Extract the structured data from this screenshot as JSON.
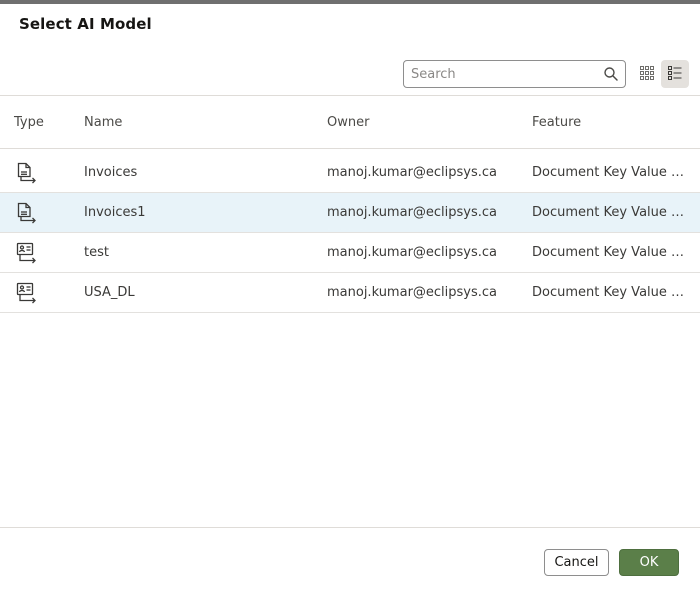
{
  "dialog": {
    "title": "Select AI Model"
  },
  "search": {
    "placeholder": "Search",
    "value": ""
  },
  "view_modes": {
    "grid_icon": "grid-view-icon",
    "list_icon": "list-view-icon",
    "selected": "list"
  },
  "table": {
    "columns": [
      "Type",
      "Name",
      "Owner",
      "Feature"
    ],
    "rows": [
      {
        "type_icon": "document-export-icon",
        "name": "Invoices",
        "owner": "manoj.kumar@eclipsys.ca",
        "feature": "Document Key Value Extraction"
      },
      {
        "type_icon": "document-export-icon",
        "name": "Invoices1",
        "owner": "manoj.kumar@eclipsys.ca",
        "feature": "Document Key Value Extraction"
      },
      {
        "type_icon": "id-card-export-icon",
        "name": "test",
        "owner": "manoj.kumar@eclipsys.ca",
        "feature": "Document Key Value Extraction"
      },
      {
        "type_icon": "id-card-export-icon",
        "name": "USA_DL",
        "owner": "manoj.kumar@eclipsys.ca",
        "feature": "Document Key Value Extraction"
      }
    ],
    "selected_row": 1
  },
  "footer": {
    "cancel_label": "Cancel",
    "ok_label": "OK"
  },
  "colors": {
    "primary_button": "#5b7f49",
    "selected_row": "#e8f3f9"
  }
}
